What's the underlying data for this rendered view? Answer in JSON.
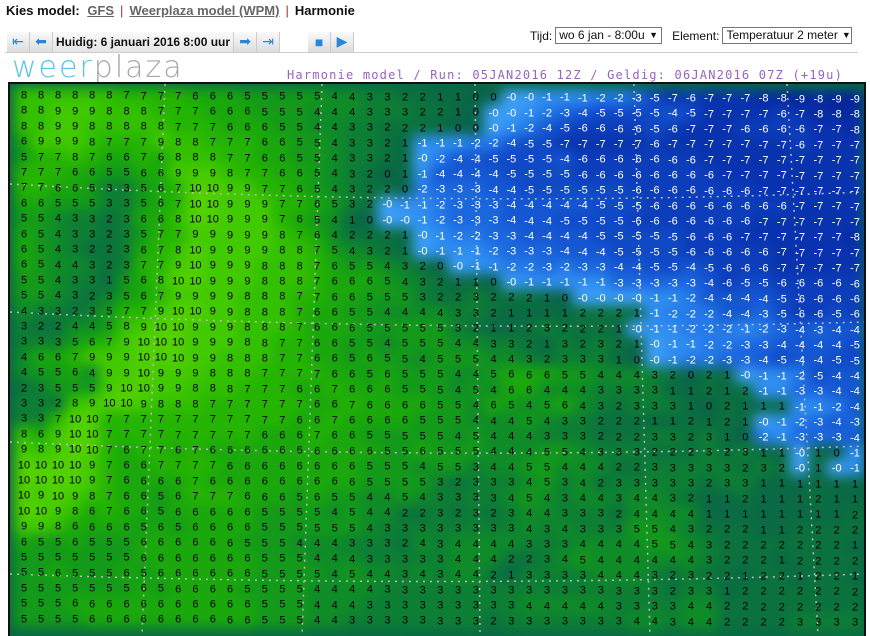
{
  "header": {
    "label": "Kies model:",
    "links": [
      "GFS",
      "Weerplaza model (WPM)"
    ],
    "separator": "|",
    "current": "Harmonie"
  },
  "toolbar": {
    "current_time": "Huidig: 6 januari 2016 8:00 uur",
    "icons": [
      "first-frame-icon",
      "previous-frame-icon",
      "next-frame-icon",
      "last-frame-icon",
      "stop-icon",
      "play-icon"
    ]
  },
  "controls": {
    "tijd_label": "Tijd:",
    "tijd_value": "wo 6 jan - 8:00u",
    "element_label": "Element:",
    "element_value": "Temperatuur 2 meter"
  },
  "logo": {
    "part1": "weer",
    "part2": "plaza"
  },
  "map": {
    "title": "Harmonie model / Run: 05JAN2016 12Z / Geldig: 06JAN2016 07Z (+19u)",
    "colors": {
      "positive_text": "#000000",
      "negative_text": "#ffffff"
    },
    "rows": [
      "8 8 8 8 8 8 7 7 7 7 6 6 6 5 5 5 5 5 4 4 3 3 2 2 1 1 0 0 -0 -0 -1 -1 -1 -2 -2 -3 -5 -7 -6 -7 -7 -7 -8 -8 -9 -8 -9 -9",
      "8 8 9 9 9 8 8 8 7 7 7 6 6 6 5 5 5 4 4 4 3 3 3 2 2 1 0 -0 -0 -1 -2 -3 -4 -5 -5 -5 -5 -4 -5 -7 -7 -7 -7 -6 -7 -8 -8 -8",
      "8 8 9 9 8 8 8 8 8 7 7 7 6 6 6 5 5 4 4 3 3 2 2 2 1 0 0 -0 -1 -2 -4 -5 -6 -6 -6 -6 -5 -6 -7 -7 -7 -6 -6 -6 -6 -7 -7 -8",
      "6 9 9 9 8 7 7 7 9 8 8 7 7 7 6 6 5 5 4 3 3 2 1 -1 -1 -1 -2 -2 -4 -5 -5 -7 -7 -7 -7 -7 -6 -7 -7 -7 -7 -7 -7 -7 -6 -7 -7 -7",
      "5 7 7 8 7 6 6 7 6 8 8 8 7 7 6 6 5 5 4 3 3 2 1 -0 -2 -4 -4 -5 -5 -5 -5 -4 -6 -6 -6 -6 -6 -6 -6 -7 -7 -7 -7 -7 -7 -7 -7 -7",
      "7 7 7 6 6 5 5 6 6 9 9 9 8 7 7 6 6 5 4 3 2 0 1 -1 -4 -4 -4 -4 -5 -5 -5 -5 -6 -6 -6 -6 -6 -6 -6 -6 -7 -7 -7 -7 -7 -7 -7 -7",
      "7 7 6 6 5 3 3 5 6 7 10 10 9 9 7 7 6 5 4 3 2 2 0 -2 -3 -3 -3 -4 -4 -5 -5 -5 -5 -5 -5 -6 -6 -6 -6 -6 -6 -6 -7 -7 -7 -7 -7 -7",
      "6 6 5 5 5 3 3 5 6 7 10 10 9 9 9 7 7 6 5 3 2 -0 -1 -1 -2 -3 -3 -3 -4 -4 -4 -4 -4 -5 -5 -5 -6 -6 -6 -6 -6 -6 -6 -6 -7 -7 -7 -7",
      "5 5 4 3 3 2 3 6 6 8 10 10 9 9 9 7 6 5 4 1 0 -0 -0 -1 -2 -3 -3 -3 -4 -4 -4 -5 -5 -5 -5 -6 -6 -6 -6 -6 -6 -6 -7 -7 -7 -7 -7 -7",
      "6 5 4 3 3 2 3 5 7 7 9 9 9 9 9 8 7 6 4 2 2 2 1 -0 -1 -2 -2 -3 -3 -4 -4 -4 -4 -5 -5 -5 -5 -5 -6 -6 -6 -7 -7 -7 -7 -7 -7 -8",
      "6 5 4 3 2 2 3 6 7 8 10 9 9 9 9 8 8 7 5 4 3 2 1 -0 -1 -1 -1 -2 -3 -3 -3 -4 -4 -4 -5 -5 -5 -5 -6 -6 -6 -6 -6 -7 -7 -7 -7 -7",
      "6 5 4 4 3 2 3 7 7 9 10 9 9 9 8 8 8 7 6 5 5 4 3 2 0 -0 -1 -1 -2 -2 -3 -2 -3 -3 -4 -4 -5 -5 -4 -5 -6 -6 -6 -7 -7 -7 -7 -7",
      "5 5 4 3 3 1 5 6 8 10 10 9 9 9 8 8 8 7 6 6 6 5 4 3 2 1 1 0 -0 -1 -1 -1 -1 -1 -3 -3 -3 -3 -3 -4 -6 -5 -5 -6 -6 -6 -6 -6",
      "5 5 4 3 2 3 5 6 7 9 9 9 9 8 8 8 7 7 6 6 5 5 5 3 2 2 3 2 2 2 1 0 -0 -0 -0 -0 -1 -1 -2 -4 -4 -4 -4 -5 -6 -6 -6 -6",
      "4 3 3 2 3 5 7 7 9 10 10 9 9 8 8 8 7 6 6 5 5 4 4 4 4 3 3 2 1 1 1 1 2 2 2 1 -1 -2 -2 -2 -4 -4 -3 -5 -6 -6 -5 -6",
      "3 2 2 4 4 5 8 9 10 10 9 9 9 8 8 8 7 6 6 6 5 5 5 5 5 3 2 1 1 2 3 2 2 2 1 -0 -1 -1 -2 -2 -2 -1 -2 -3 -4 -3 -4 -4",
      "3 3 3 5 6 7 9 10 10 10 9 9 9 8 8 7 7 6 6 5 5 4 5 5 5 4 4 3 3 2 1 3 2 3 2 1 -0 -1 -1 -2 -2 -3 -3 -4 -4 -4 -4 -5",
      "4 6 6 7 9 9 9 10 10 10 9 9 8 8 8 7 7 6 6 5 6 5 5 4 5 5 5 4 4 3 2 3 3 3 1 0 -0 -1 -2 -2 -3 -3 -4 -5 -4 -4 -5 -5",
      "4 5 5 6 4 9 9 10 9 9 9 8 8 8 7 7 7 7 6 6 5 6 5 5 5 4 4 5 6 6 6 5 5 4 4 4 3 2 0 2 1 -0 -1 -1 -2 -5 -4 -4",
      "2 3 5 5 5 9 10 10 9 9 8 8 8 7 7 7 6 6 7 6 6 6 5 5 5 4 5 4 6 6 4 4 4 3 3 3 3 1 1 2 1 2 -1 -1 -3 -3 -4 -4",
      "3 3 2 8 9 10 10 9 8 8 8 7 7 7 7 7 7 6 6 7 6 6 6 6 5 5 4 6 5 4 5 6 4 3 2 3 3 3 1 0 2 1 1 1 -1 -1 -2 -4",
      "3 3 7 10 10 7 7 7 7 7 7 7 7 7 7 7 6 6 7 6 6 6 6 5 5 5 4 4 4 5 4 3 3 2 2 2 1 1 2 1 2 1 -0 -1 -2 -3 -4 -3",
      "8 6 9 10 10 7 7 7 7 7 7 7 7 7 6 6 6 7 6 6 5 5 5 5 5 4 5 4 4 4 3 3 3 2 2 2 3 3 2 3 1 0 -2 -1 -3 -3 -3 -4",
      "9 8 9 10 10 7 6 7 7 6 7 6 6 6 6 6 6 6 6 6 6 5 5 6 5 5 5 4 4 4 5 5 4 3 3 3 2 2 2 3 2 3 1 1 -0 1 0 -1",
      "10 10 10 10 9 7 6 6 7 7 7 7 6 6 6 6 6 6 6 6 5 5 5 4 5 5 3 4 4 5 5 4 4 4 2 2 3 3 3 3 3 2 3 2 -0 1 -0 -1",
      "10 10 10 10 9 7 6 6 6 6 7 6 6 6 6 6 6 6 6 6 5 5 5 5 3 2 3 3 3 4 5 3 4 2 3 3 3 3 3 2 3 3 1 1 1 1 1 1",
      "10 9 10 9 8 7 6 6 5 6 7 7 7 6 6 6 5 6 5 5 4 4 5 4 3 3 3 3 4 5 4 3 4 4 3 4 4 3 2 1 1 2 1 1 1 2 1 1",
      "10 10 9 8 6 7 6 6 5 6 6 6 6 6 5 5 5 5 4 5 4 4 2 2 3 2 3 2 3 4 4 3 3 3 2 4 4 4 4 1 1 1 1 1 1 1 1 2",
      "9 9 8 6 6 6 6 5 6 5 6 6 6 6 5 5 5 5 5 5 4 3 3 3 3 3 3 3 3 4 3 4 3 3 3 5 5 4 3 2 2 2 1 1 2 2 2 2",
      "6 5 5 6 5 5 5 6 6 6 6 6 6 5 5 5 4 4 4 3 3 3 2 4 3 4 4 4 4 3 3 3 4 4 4 4 5 5 4 3 2 2 2 2 2 2 2 1",
      "5 5 5 5 5 5 5 6 6 6 6 6 6 6 5 5 5 4 4 4 3 3 3 3 3 4 4 4 2 2 3 4 5 4 4 4 4 4 4 3 2 2 2 1 2 2 2 2",
      "5 5 6 5 5 5 6 5 6 6 6 6 6 6 5 5 5 5 4 5 4 4 3 4 3 4 4 2 1 3 3 3 3 4 4 4 3 2 3 2 2 1 2 2 1 2 2 1",
      "5 5 5 5 5 5 5 6 5 6 6 6 6 5 5 5 5 4 4 4 4 3 3 3 3 3 3 3 3 3 3 3 3 3 3 3 3 2 3 3 1 2 2 2 2 2 2 2",
      "5 5 5 6 6 6 6 6 6 6 6 6 6 6 5 5 5 4 4 4 3 3 3 3 3 3 3 3 3 4 4 4 4 4 3 3 3 3 4 4 2 2 2 2 2 2 2 2",
      "5 5 5 5 6 6 6 6 6 6 6 6 6 6 5 5 5 4 4 3 3 3 3 3 3 3 3 2 3 3 3 3 3 3 3 4 4 3 4 4 2 2 2 2 3 3 3 3"
    ]
  }
}
